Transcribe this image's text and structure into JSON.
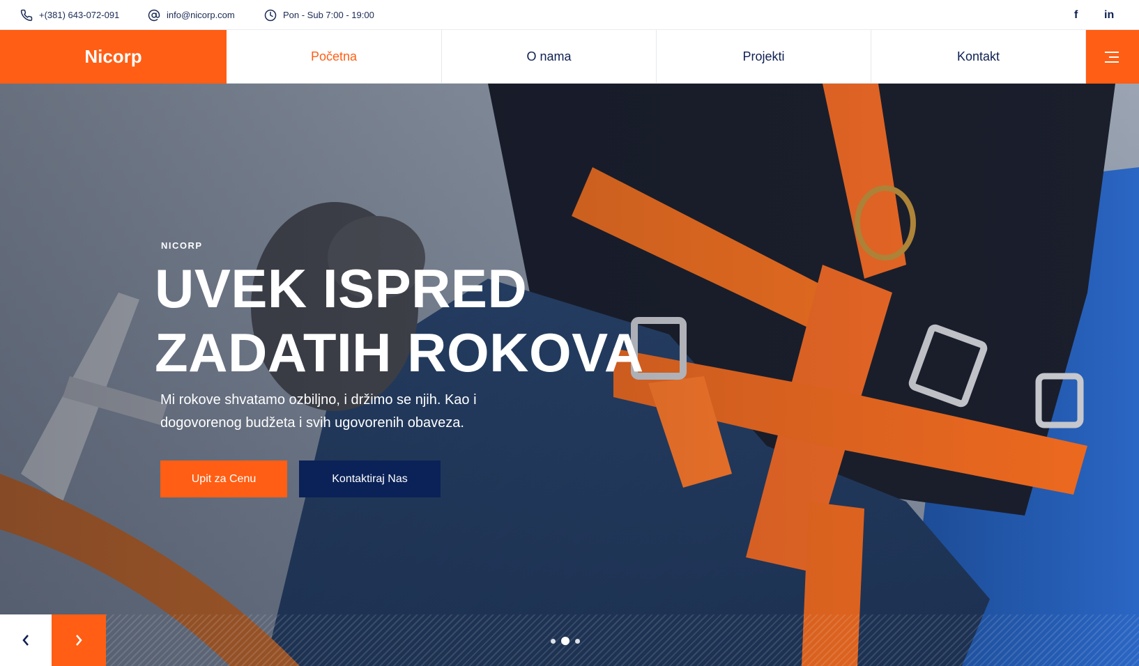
{
  "topbar": {
    "phone": "+(381) 643-072-091",
    "email": "info@nicorp.com",
    "hours": "Pon - Sub 7:00 - 19:00",
    "social": [
      {
        "icon": "facebook-icon",
        "label": "f"
      },
      {
        "icon": "linkedin-icon",
        "label": "in"
      }
    ]
  },
  "nav": {
    "logo": "Nicorp",
    "items": [
      {
        "label": "Početna",
        "active": true
      },
      {
        "label": "O nama",
        "active": false
      },
      {
        "label": "Projekti",
        "active": false
      },
      {
        "label": "Kontakt",
        "active": false
      }
    ],
    "menu_icon": "hamburger-icon"
  },
  "hero": {
    "eyebrow": "NICORP",
    "headline_line1": "UVEK ISPRED",
    "headline_line2": "ZADATIH ROKOVA",
    "lead": "Mi rokove shvatamo ozbiljno, i držimo se njih. Kao i dogovorenog budžeta i svih ugovorenih obaveza.",
    "button_primary": "Upit za Cenu",
    "button_secondary": "Kontaktiraj Nas",
    "slides_count": 3,
    "active_slide": 2
  },
  "colors": {
    "accent": "#ff5e14",
    "navy": "#0b2258",
    "text_dark": "#0e2052"
  }
}
